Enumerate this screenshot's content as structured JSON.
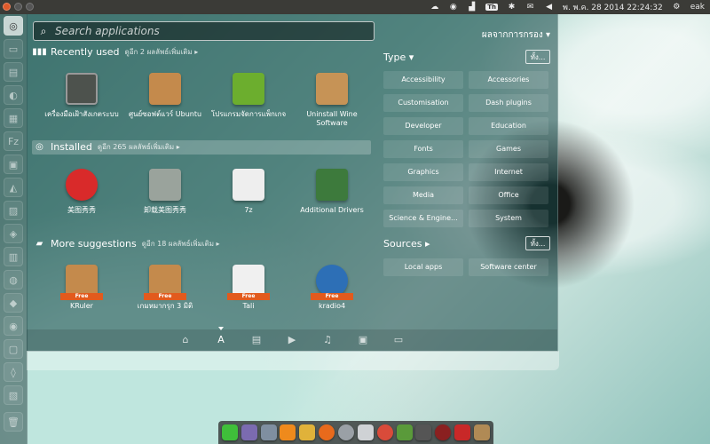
{
  "top_panel": {
    "datetime": "พ. พ.ค. 28 2014 22:24:32",
    "username": "eak",
    "keyboard_layout": "Th"
  },
  "search": {
    "placeholder": "Search applications"
  },
  "filter_results_label": "ผลจากการกรอง ▾",
  "sections": {
    "recent": {
      "title": "Recently used",
      "more": "ดูอีก 2 ผลลัพธ์เพิ่มเติม ▸"
    },
    "installed": {
      "title": "Installed",
      "more": "ดูอีก 265 ผลลัพธ์เพิ่มเติม ▸"
    },
    "suggestions": {
      "title": "More suggestions",
      "more": "ดูอีก 18 ผลลัพธ์เพิ่มเติม ▸"
    }
  },
  "apps": {
    "recent": [
      {
        "label": "เครื่องมือเฝ้าสังเกตระบบ",
        "icon": "system-monitor-icon",
        "color": "#555a55"
      },
      {
        "label": "ศูนย์ซอฟต์แวร์ Ubuntu",
        "icon": "software-center-icon",
        "color": "#c48a4c"
      },
      {
        "label": "โปรแกรมจัดการแพ็กเกจ",
        "icon": "synaptic-icon",
        "color": "#6cae2e"
      },
      {
        "label": "Uninstall Wine Software",
        "icon": "wine-uninstall-icon",
        "color": "#c69356"
      }
    ],
    "installed": [
      {
        "label": "美图秀秀",
        "icon": "meitu-icon",
        "color": "#d92a2a"
      },
      {
        "label": "卸载美图秀秀",
        "icon": "trash-icon",
        "color": "#9aa39c"
      },
      {
        "label": "7z",
        "icon": "7z-icon",
        "color": "#eeeeee"
      },
      {
        "label": "Additional Drivers",
        "icon": "additional-drivers-icon",
        "color": "#3d7a3c"
      }
    ],
    "suggestions": [
      {
        "label": "KRuler",
        "icon": "kruler-icon",
        "color": "#c48a4c",
        "free": "Free"
      },
      {
        "label": "เกมหมากรุก 3 มิติ",
        "icon": "chess-icon",
        "color": "#c48a4c",
        "free": "Free"
      },
      {
        "label": "Tali",
        "icon": "dice-icon",
        "color": "#f0f0f0",
        "free": "Free"
      },
      {
        "label": "kradio4",
        "icon": "kradio-icon",
        "color": "#2d6fb6",
        "free": "Free"
      }
    ]
  },
  "filters": {
    "type_label": "Type ▾",
    "sources_label": "Sources ▸",
    "all_label": "ทั้ง...",
    "types": [
      "Accessibility",
      "Accessories",
      "Customisation",
      "Dash plugins",
      "Developer",
      "Education",
      "Fonts",
      "Games",
      "Graphics",
      "Internet",
      "Media",
      "Office",
      "Science & Engine...",
      "System"
    ],
    "sources": [
      "Local apps",
      "Software center"
    ]
  },
  "lenses": [
    "home-lens-icon",
    "applications-lens-icon",
    "files-lens-icon",
    "video-lens-icon",
    "music-lens-icon",
    "photo-lens-icon",
    "social-lens-icon"
  ],
  "dock": [
    {
      "name": "line-icon",
      "color": "#3fbf3a"
    },
    {
      "name": "pidgin-icon",
      "color": "#7b6bb0"
    },
    {
      "name": "files-icon",
      "color": "#7f8fa0"
    },
    {
      "name": "vlc-icon",
      "color": "#ef8a1c"
    },
    {
      "name": "diamond-icon",
      "color": "#e0b23a"
    },
    {
      "name": "firefox-icon",
      "color": "#e86a1c"
    },
    {
      "name": "sphere-icon",
      "color": "#9aa0a6"
    },
    {
      "name": "robot-icon",
      "color": "#cfd2d5"
    },
    {
      "name": "chrome-icon",
      "color": "#d94b3a"
    },
    {
      "name": "chart-icon",
      "color": "#5a9a3a"
    },
    {
      "name": "disk-icon",
      "color": "#555555"
    },
    {
      "name": "target-icon",
      "color": "#8a2020"
    },
    {
      "name": "pdf-icon",
      "color": "#c82828"
    },
    {
      "name": "folder-icon",
      "color": "#b08a55"
    }
  ]
}
